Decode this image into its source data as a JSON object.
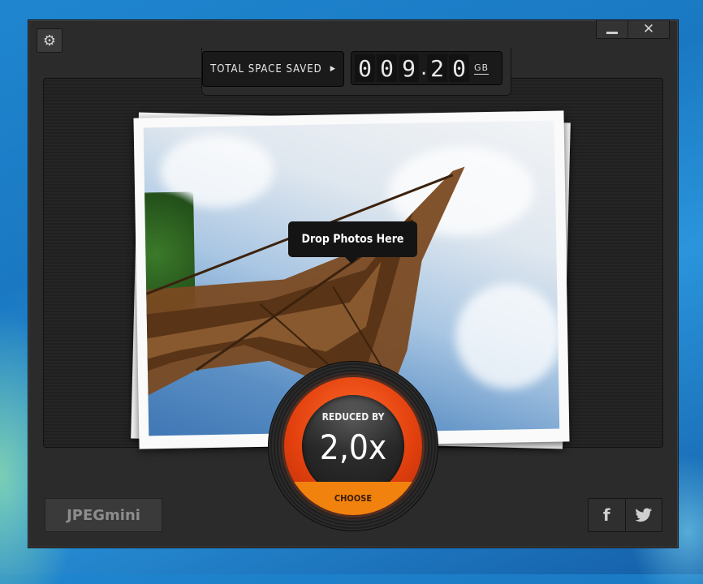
{
  "window": {
    "minimize_icon": "minimize-icon",
    "close_icon": "close-icon",
    "close_glyph": "✕",
    "settings_icon": "gear-icon",
    "settings_glyph": "⚙"
  },
  "counter": {
    "label": "TOTAL SPACE SAVED",
    "play_glyph": "▶",
    "digits": [
      "0",
      "0",
      "9"
    ],
    "separator": ".",
    "decimals": [
      "2",
      "0"
    ],
    "unit": "GB"
  },
  "drop_zone": {
    "prompt": "Drop Photos Here"
  },
  "dial": {
    "reduced_label": "REDUCED BY",
    "reduced_value": "2,0x",
    "choose_label": "CHOOSE",
    "ring_color": "#e2400e",
    "choose_color": "#f2820e"
  },
  "footer": {
    "logo_text": "JPEGmini",
    "facebook_glyph": "f",
    "twitter_glyph": "🐦"
  }
}
